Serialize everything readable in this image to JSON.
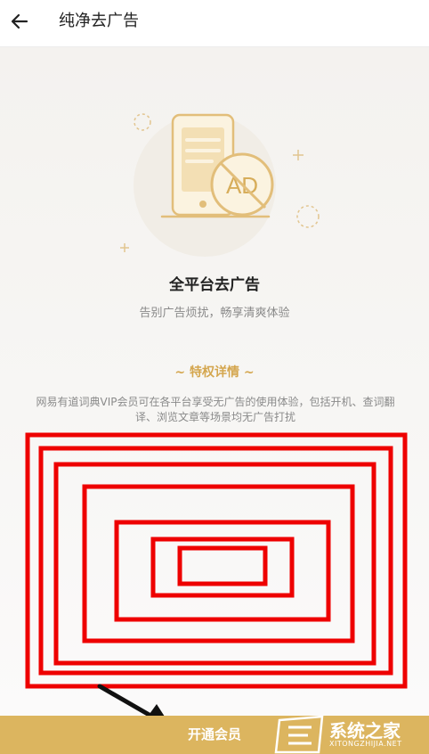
{
  "header": {
    "title": "纯净去广告"
  },
  "hero": {
    "ad_badge": "AD"
  },
  "feature": {
    "title": "全平台去广告",
    "subtitle": "告别广告烦扰，畅享清爽体验"
  },
  "details": {
    "section_title": "~ 特权详情 ~",
    "description": "网易有道词典VIP会员可在各平台享受无广告的使用体验，包括开机、查词翻译、浏览文章等场景均无广告打扰"
  },
  "cta": {
    "label": "开通会员"
  },
  "watermark": {
    "brand": "系统之家",
    "url": "XITONGZHIJIA.NET"
  },
  "colors": {
    "accent": "#dcb55f",
    "annotation_red": "#ee0000"
  }
}
